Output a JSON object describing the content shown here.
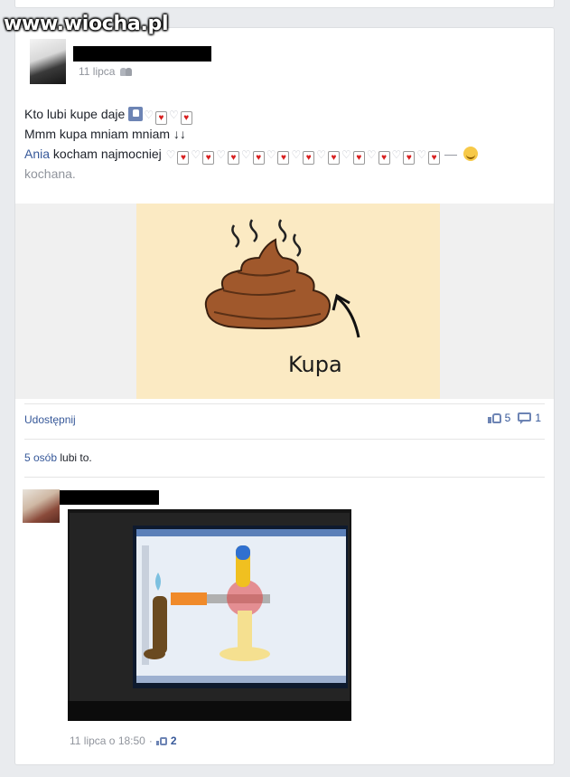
{
  "watermark": {
    "text": "www.wiocha.pl"
  },
  "post": {
    "date": "11 lipca",
    "audience_icon": "friends-icon",
    "lines": {
      "l1_text": "Kto lubi kupe daje",
      "l2_text": "Mmm kupa mniam mniam",
      "l2_arrows": "↓↓",
      "l3_tag": "Ania",
      "l3_text": "kocham najmocniej",
      "l3_dash": "—",
      "l4_text": "kochana."
    },
    "image": {
      "caption_word": "Kupa",
      "background": "#fbeac3",
      "poop_color": "#a0582c"
    }
  },
  "actions": {
    "share_label": "Udostępnij",
    "like_count": "5",
    "comment_count": "1",
    "likes_summary_link": "5 osób",
    "likes_summary_text": "lubi to."
  },
  "comment": {
    "timestamp": "11 lipca o 18:50",
    "separator": "·",
    "like_count": "2"
  },
  "colors": {
    "link": "#365899",
    "muted": "#90949c",
    "page_bg": "#e9ebee",
    "card_bg": "#ffffff"
  }
}
